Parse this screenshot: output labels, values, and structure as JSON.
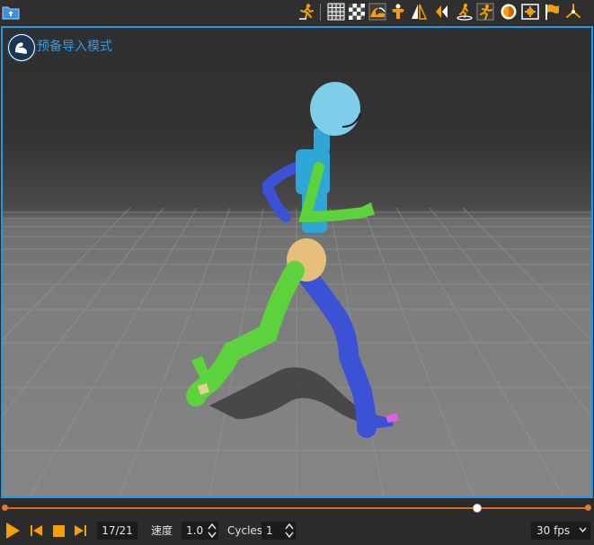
{
  "viewport": {
    "mode_label": "预备导入模式"
  },
  "timeline": {
    "current_frame": 17,
    "total_frames": 21,
    "frame_display": "17/21",
    "playhead_fraction": 0.81
  },
  "controls": {
    "speed_label": "速度",
    "speed_value": "1.0",
    "cycles_label": "Cycles:",
    "cycles_value": "1",
    "fps_value": "30 fps"
  },
  "toolbar": {
    "icons": [
      "import-folder-icon",
      "character-pose-icon",
      "grid-icon",
      "checkerboard-icon",
      "wave-icon",
      "muscle-figure-icon",
      "mirror-icon",
      "previous-icon",
      "ground-skate-icon",
      "running-figure-icon",
      "circle-target-icon",
      "frame-center-icon",
      "flag-icon",
      "axis-icon"
    ]
  },
  "colors": {
    "accent": "#1e98e8",
    "timeline": "#d96a1a",
    "icon_orange": "#f5a000",
    "label_blue": "#2a9df4"
  }
}
